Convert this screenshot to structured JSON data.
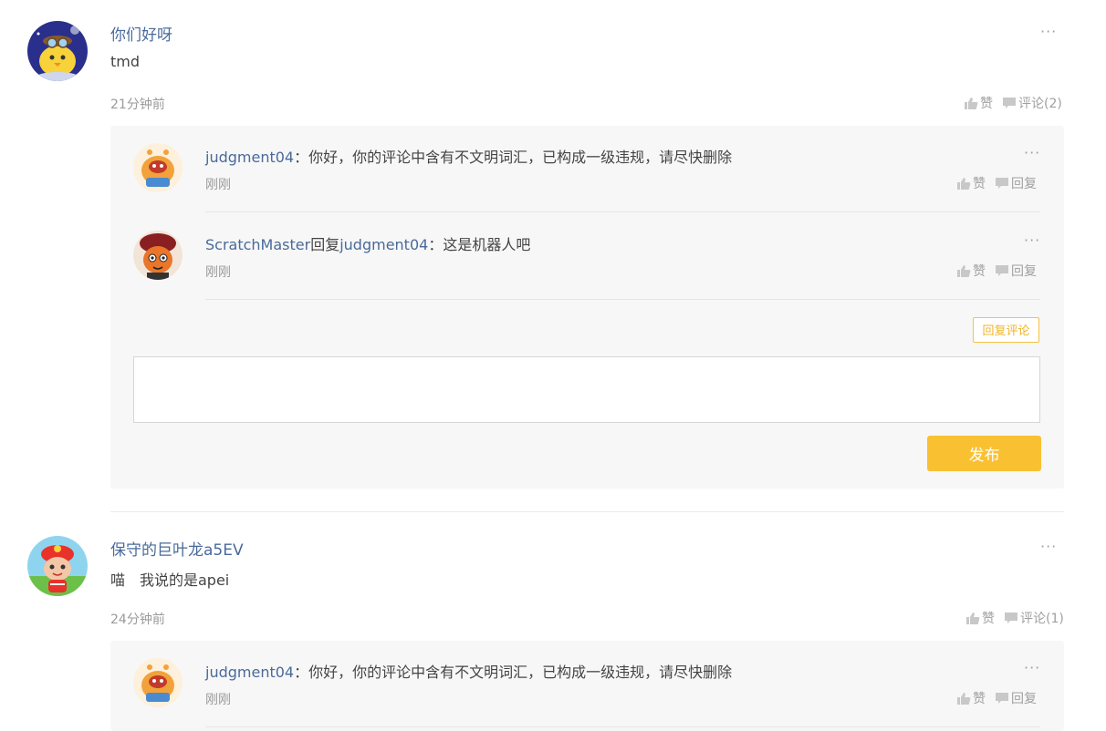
{
  "comments": [
    {
      "author": "你们好呀",
      "text": "tmd",
      "time": "21分钟前",
      "like_label": "赞",
      "comment_label": "评论(2)",
      "replies": [
        {
          "name": "judgment04",
          "reply_to_word": "",
          "reply_to": "",
          "text": "：你好，你的评论中含有不文明词汇，已构成一级违规，请尽快删除",
          "time": "刚刚",
          "like_label": "赞",
          "reply_label": "回复"
        },
        {
          "name": "ScratchMaster",
          "reply_to_word": "回复",
          "reply_to": "judgment04",
          "text": "：这是机器人吧",
          "time": "刚刚",
          "like_label": "赞",
          "reply_label": "回复"
        }
      ],
      "reply_comment_button": "回复评论",
      "submit_button": "发布"
    },
    {
      "author": "保守的巨叶龙a5EV",
      "text": "喵　我说的是apei",
      "time": "24分钟前",
      "like_label": "赞",
      "comment_label": "评论(1)",
      "replies": [
        {
          "name": "judgment04",
          "text": "：你好，你的评论中含有不文明词汇，已构成一级违规，请尽快删除",
          "time": "刚刚",
          "like_label": "赞",
          "reply_label": "回复"
        }
      ]
    }
  ],
  "more_glyph": "···",
  "colors": {
    "accent_yellow": "#f9c132",
    "author_blue": "#4a6a9a",
    "panel_bg": "#f7f7f7"
  }
}
